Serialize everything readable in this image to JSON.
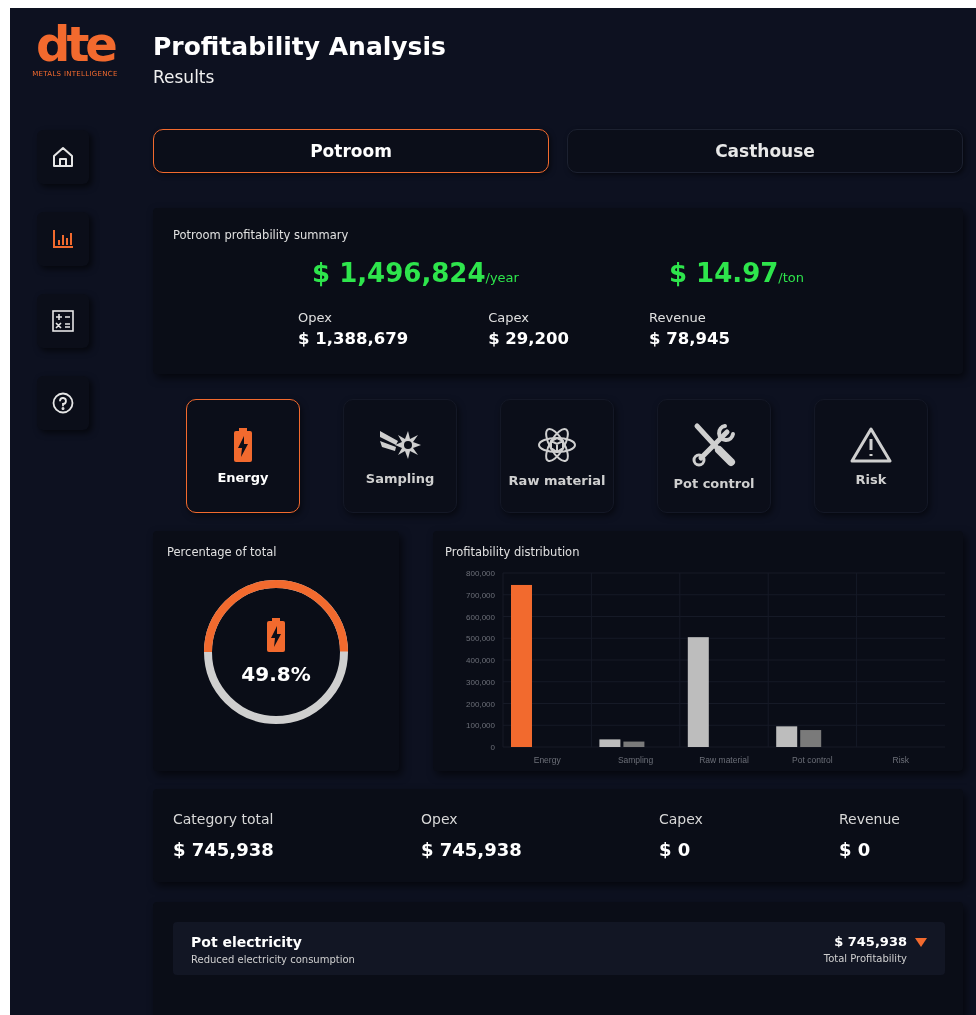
{
  "logo": {
    "mark": "dte",
    "tagline": "METALS INTELLIGENCE"
  },
  "header": {
    "title": "Profitability Analysis",
    "subtitle": "Results"
  },
  "sidebar": {
    "items": [
      {
        "kind": "home",
        "selected": false
      },
      {
        "kind": "chart",
        "selected": true
      },
      {
        "kind": "calculator",
        "selected": false
      },
      {
        "kind": "help",
        "selected": false
      }
    ]
  },
  "tabs": [
    {
      "label": "Potroom",
      "selected": true
    },
    {
      "label": "Casthouse",
      "selected": false
    }
  ],
  "summary": {
    "title": "Potroom profitability summary",
    "totals": [
      {
        "value": "$ 1,496,824",
        "unit": "/year"
      },
      {
        "value": "$ 14.97",
        "unit": "/ton"
      }
    ],
    "metrics": [
      {
        "label": "Opex",
        "value": "$ 1,388,679"
      },
      {
        "label": "Capex",
        "value": "$ 29,200"
      },
      {
        "label": "Revenue",
        "value": "$ 78,945"
      }
    ]
  },
  "categories": [
    {
      "kind": "energy",
      "label": "Energy",
      "selected": true
    },
    {
      "kind": "sampling",
      "label": "Sampling",
      "selected": false
    },
    {
      "kind": "raw_material",
      "label": "Raw material",
      "selected": false
    },
    {
      "kind": "pot_control",
      "label": "Pot control",
      "selected": false
    },
    {
      "kind": "risk",
      "label": "Risk",
      "selected": false
    }
  ],
  "percentage": {
    "title": "Percentage of total",
    "value": "49.8%",
    "level": 0.498
  },
  "distribution": {
    "title": "Profitability distribution",
    "chart_data": {
      "type": "bar",
      "categories": [
        "Energy",
        "Sampling",
        "Raw material",
        "Pot control",
        "Risk"
      ],
      "series": [
        {
          "color": "#f26a2e",
          "values": [
            745000,
            null,
            null,
            null,
            null
          ]
        },
        {
          "color": "#bdbdbd",
          "values": [
            null,
            35000,
            505000,
            95000,
            null
          ]
        },
        {
          "color": "#7a7a7a",
          "values": [
            null,
            25000,
            null,
            78000,
            null
          ]
        }
      ],
      "grid": true,
      "ylim": [
        0,
        800000
      ],
      "yticks": [
        {
          "value": 0,
          "label": "0"
        },
        {
          "value": 100000,
          "label": "100,000"
        },
        {
          "value": 200000,
          "label": "200,000"
        },
        {
          "value": 300000,
          "label": "300,000"
        },
        {
          "value": 400000,
          "label": "400,000"
        },
        {
          "value": 500000,
          "label": "500,000"
        },
        {
          "value": 600000,
          "label": "600,000"
        },
        {
          "value": 700000,
          "label": "700,000"
        },
        {
          "value": 800000,
          "label": "800,000"
        }
      ]
    }
  },
  "category_stats": [
    {
      "label": "Category total",
      "value": "$ 745,938"
    },
    {
      "label": "Opex",
      "value": "$ 745,938"
    },
    {
      "label": "Capex",
      "value": "$ 0"
    },
    {
      "label": "Revenue",
      "value": "$ 0"
    }
  ],
  "items": [
    {
      "title": "Pot electricity",
      "subtitle": "Reduced electricity consumption",
      "value": "$ 745,938",
      "value_label": "Total Profitability"
    }
  ]
}
